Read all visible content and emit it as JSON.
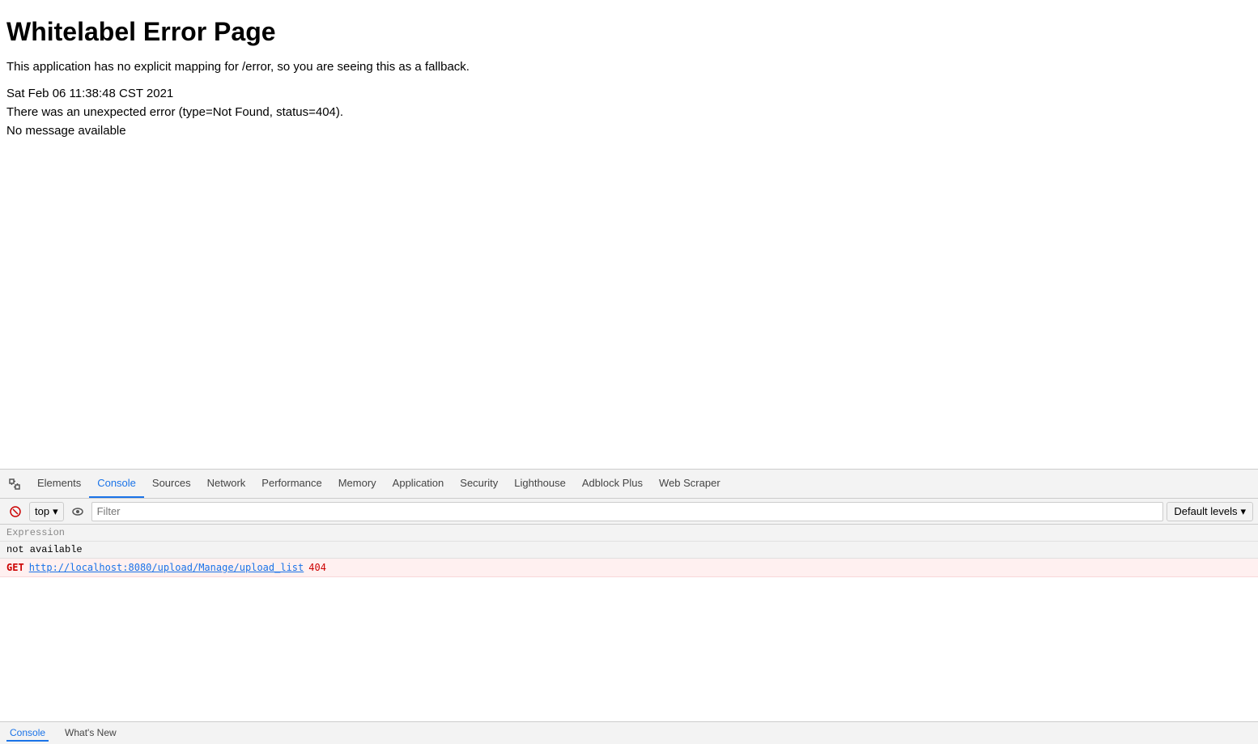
{
  "page": {
    "error_title": "Whitelabel Error Page",
    "error_subtitle": "This application has no explicit mapping for /error, so you are seeing this as a fallback.",
    "error_timestamp": "Sat Feb 06 11:38:48 CST 2021",
    "error_type": "There was an unexpected error (type=Not Found, status=404).",
    "error_message": "No message available"
  },
  "devtools": {
    "tabs": [
      {
        "label": "Elements",
        "active": false
      },
      {
        "label": "Console",
        "active": true
      },
      {
        "label": "Sources",
        "active": false
      },
      {
        "label": "Network",
        "active": false
      },
      {
        "label": "Performance",
        "active": false
      },
      {
        "label": "Memory",
        "active": false
      },
      {
        "label": "Application",
        "active": false
      },
      {
        "label": "Security",
        "active": false
      },
      {
        "label": "Lighthouse",
        "active": false
      },
      {
        "label": "Adblock Plus",
        "active": false
      },
      {
        "label": "Web Scraper",
        "active": false
      }
    ],
    "console": {
      "context_value": "top",
      "filter_placeholder": "Filter",
      "levels_label": "Default levels",
      "expression_label": "Expression",
      "not_available_text": "not available",
      "error_method": "GET",
      "error_url": "http://localhost:8080/upload/Manage/upload_list",
      "error_status": "404"
    },
    "bottom_tabs": [
      {
        "label": "Console",
        "active": true
      },
      {
        "label": "What's New",
        "active": false
      }
    ]
  }
}
